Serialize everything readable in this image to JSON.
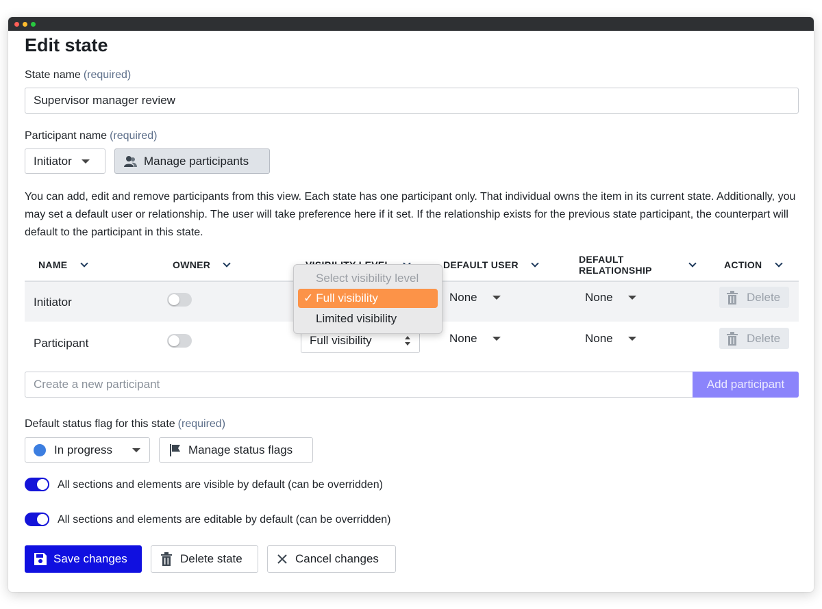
{
  "page": {
    "title": "Edit state"
  },
  "state_name": {
    "label": "State name",
    "required": "(required)",
    "value": "Supervisor manager review"
  },
  "participant_name": {
    "label": "Participant name",
    "required": "(required)",
    "selected": "Initiator",
    "manage_label": "Manage participants"
  },
  "description": "You can add, edit and remove participants from this view. Each state has one participant only. That individual owns the item in its current state. Additionally, you may set a default user or relationship. The user will take preference here if it set. If the relationship exists for the previous state participant, the counterpart will default to the participant in this state.",
  "table": {
    "headers": {
      "name": "NAME",
      "owner": "OWNER",
      "visibility": "VISIBILITY LEVEL",
      "default_user": "DEFAULT USER",
      "default_relationship_1": "DEFAULT",
      "default_relationship_2": "RELATIONSHIP",
      "action": "ACTION"
    },
    "rows": [
      {
        "name": "Initiator",
        "owner": false,
        "visibility": "Full visibility",
        "default_user": "None",
        "default_relationship": "None",
        "action": "Delete"
      },
      {
        "name": "Participant",
        "owner": false,
        "visibility": "Full visibility",
        "default_user": "None",
        "default_relationship": "None",
        "action": "Delete"
      }
    ]
  },
  "visibility_dropdown": {
    "placeholder": "Select visibility level",
    "options": [
      "Full visibility",
      "Limited visibility"
    ],
    "selected": "Full visibility",
    "check": "✓"
  },
  "new_participant": {
    "placeholder": "Create a new participant",
    "button": "Add participant"
  },
  "status_flag": {
    "label": "Default status flag for this state",
    "required": "(required)",
    "selected": "In progress",
    "dot_color": "#3c7ee0",
    "manage_label": "Manage status flags"
  },
  "toggles": {
    "visible_label": "All sections and elements are visible by default (can be overridden)",
    "visible_on": true,
    "editable_label": "All sections and elements are editable by default (can be overridden)",
    "editable_on": true
  },
  "actions": {
    "save": "Save changes",
    "delete": "Delete state",
    "cancel": "Cancel changes"
  },
  "colors": {
    "primary": "#1010e0",
    "add_participant": "#8b84fb",
    "dropdown_selected": "#fc9348"
  }
}
